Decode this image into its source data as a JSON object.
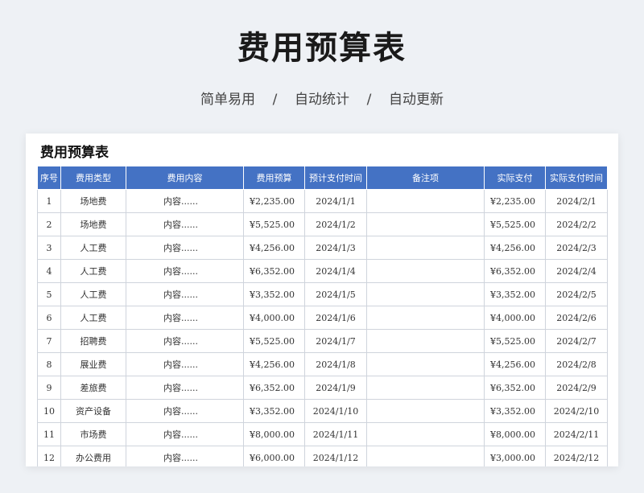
{
  "page": {
    "title": "费用预算表",
    "subtitle": "简单易用    /    自动统计    /    自动更新"
  },
  "sheet": {
    "title": "费用预算表",
    "headers": [
      "序号",
      "费用类型",
      "费用内容",
      "费用预算",
      "预计支付时间",
      "备注项",
      "实际支付",
      "实际支付时间"
    ],
    "rows": [
      [
        "1",
        "场地费",
        "内容......",
        "¥2,235.00",
        "2024/1/1",
        "",
        "¥2,235.00",
        "2024/2/1"
      ],
      [
        "2",
        "场地费",
        "内容......",
        "¥5,525.00",
        "2024/1/2",
        "",
        "¥5,525.00",
        "2024/2/2"
      ],
      [
        "3",
        "人工费",
        "内容......",
        "¥4,256.00",
        "2024/1/3",
        "",
        "¥4,256.00",
        "2024/2/3"
      ],
      [
        "4",
        "人工费",
        "内容......",
        "¥6,352.00",
        "2024/1/4",
        "",
        "¥6,352.00",
        "2024/2/4"
      ],
      [
        "5",
        "人工费",
        "内容......",
        "¥3,352.00",
        "2024/1/5",
        "",
        "¥3,352.00",
        "2024/2/5"
      ],
      [
        "6",
        "人工费",
        "内容......",
        "¥4,000.00",
        "2024/1/6",
        "",
        "¥4,000.00",
        "2024/2/6"
      ],
      [
        "7",
        "招聘费",
        "内容......",
        "¥5,525.00",
        "2024/1/7",
        "",
        "¥5,525.00",
        "2024/2/7"
      ],
      [
        "8",
        "展业费",
        "内容......",
        "¥4,256.00",
        "2024/1/8",
        "",
        "¥4,256.00",
        "2024/2/8"
      ],
      [
        "9",
        "差旅费",
        "内容......",
        "¥6,352.00",
        "2024/1/9",
        "",
        "¥6,352.00",
        "2024/2/9"
      ],
      [
        "10",
        "资产设备",
        "内容......",
        "¥3,352.00",
        "2024/1/10",
        "",
        "¥3,352.00",
        "2024/2/10"
      ],
      [
        "11",
        "市场费",
        "内容......",
        "¥8,000.00",
        "2024/1/11",
        "",
        "¥8,000.00",
        "2024/2/11"
      ],
      [
        "12",
        "办公费用",
        "内容......",
        "¥6,000.00",
        "2024/1/12",
        "",
        "¥3,000.00",
        "2024/2/12"
      ]
    ]
  },
  "colors": {
    "header_bg": "#4472c4",
    "page_bg": "#eef1f5"
  }
}
